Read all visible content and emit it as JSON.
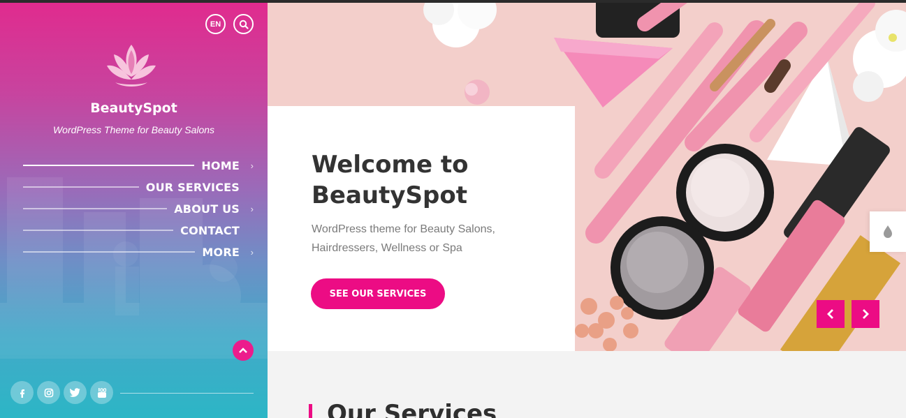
{
  "header": {
    "lang": "EN"
  },
  "brand": {
    "name": "BeautySpot",
    "tagline": "WordPress Theme for Beauty Salons"
  },
  "nav": {
    "items": [
      {
        "label": "HOME",
        "active": true,
        "has_submenu": true
      },
      {
        "label": "OUR SERVICES",
        "active": false,
        "has_submenu": false
      },
      {
        "label": "ABOUT US",
        "active": false,
        "has_submenu": true
      },
      {
        "label": "CONTACT",
        "active": false,
        "has_submenu": false
      },
      {
        "label": "MORE",
        "active": false,
        "has_submenu": true
      }
    ]
  },
  "social": [
    "facebook-icon",
    "instagram-icon",
    "twitter-icon",
    "youtube-icon"
  ],
  "hero": {
    "title": "Welcome to BeautySpot",
    "subtitle": "WordPress theme for Beauty Salons, Hairdressers, Wellness or Spa",
    "cta": "SEE OUR SERVICES"
  },
  "services": {
    "title": "Our Services"
  },
  "colors": {
    "accent": "#ec0c84",
    "sidebar_top": "#e02b8e",
    "sidebar_bottom": "#2cb6c6",
    "heading": "#333333"
  }
}
